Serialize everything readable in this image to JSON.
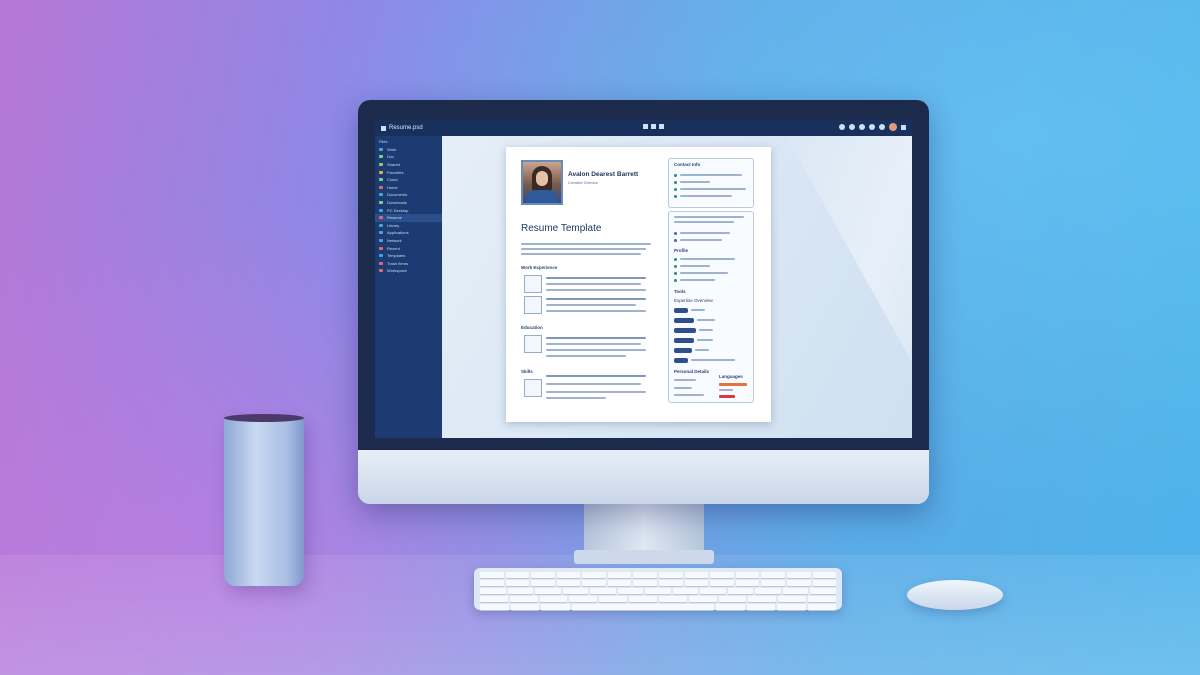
{
  "app": {
    "window_title": "Resume.psd"
  },
  "sidebar": {
    "header": "Files",
    "items": [
      {
        "label": "Work",
        "color": "#4aa3df"
      },
      {
        "label": "Doc",
        "color": "#7fcf8a"
      },
      {
        "label": "Shared",
        "color": "#8ad06a"
      },
      {
        "label": "Favorites",
        "color": "#e0b050"
      },
      {
        "label": "Cloud",
        "color": "#7fcf8a"
      },
      {
        "label": "Home",
        "color": "#e06a6a"
      },
      {
        "label": "Documents",
        "color": "#4aa3df"
      },
      {
        "label": "Downloads",
        "color": "#7fcf8a"
      },
      {
        "label": "PC Desktop",
        "color": "#4aa3df"
      },
      {
        "label": "Resume",
        "color": "#e06a6a",
        "active": true
      },
      {
        "label": "Library",
        "color": "#4aa3df"
      },
      {
        "label": "Applications",
        "color": "#4aa3df"
      },
      {
        "label": "Network",
        "color": "#4aa3df"
      },
      {
        "label": "Recent",
        "color": "#e06a6a"
      },
      {
        "label": "Templates",
        "color": "#4aa3df"
      },
      {
        "label": "Trash Items",
        "color": "#e06a6a"
      },
      {
        "label": "Workspace",
        "color": "#e06a6a"
      }
    ]
  },
  "resume": {
    "name": "Avalon Dearest Barrett",
    "subtitle": "Creative Director",
    "heading": "Resume Template",
    "sections": {
      "experience": "Work Experience",
      "education": "Education",
      "skills": "Skills",
      "contact": "Contact Info",
      "profile": "Profile",
      "tools": "Tools",
      "expertise": "Expertise Overview",
      "personal": "Personal Details",
      "languages": "Languages"
    }
  },
  "colors": {
    "accent": "#2e5088",
    "bullet_green": "#2a8c7a",
    "skill_orange": "#e8703a",
    "skill_red": "#d63a4a"
  }
}
